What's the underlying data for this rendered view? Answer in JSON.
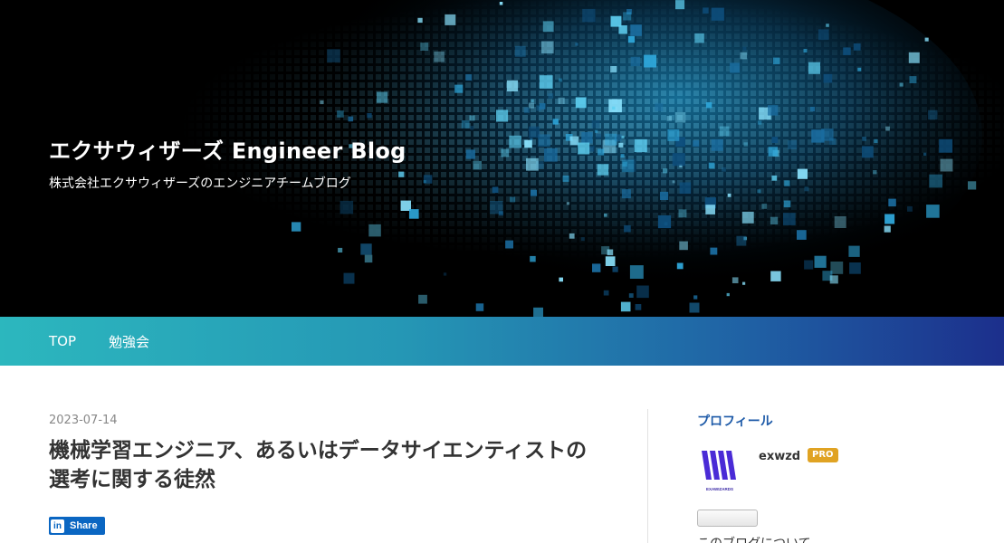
{
  "blog": {
    "title": "エクサウィザーズ Engineer Blog",
    "description": "株式会社エクサウィザーズのエンジニアチームブログ"
  },
  "nav": {
    "items": [
      {
        "label": "TOP"
      },
      {
        "label": "勉強会"
      }
    ]
  },
  "post": {
    "date": "2023-07-14",
    "title": "機械学習エンジニア、あるいはデータサイエンティストの選考に関する徒然",
    "share_label": "Share",
    "share_logo": "in"
  },
  "sidebar": {
    "heading": "プロフィール",
    "avatar_caption": "EXAWIZARDS",
    "username": "exwzd",
    "badge": "PRO",
    "about_link": "このブログについて"
  },
  "colors": {
    "nav_gradient_start": "#2cb7be",
    "nav_gradient_end": "#1c2f8c",
    "heading_blue": "#1d5aa8",
    "pro_badge": "#e0a323",
    "linkedin": "#0a66c2"
  },
  "icons": {
    "share": "linkedin-icon",
    "avatar": "exawizards-logo"
  }
}
